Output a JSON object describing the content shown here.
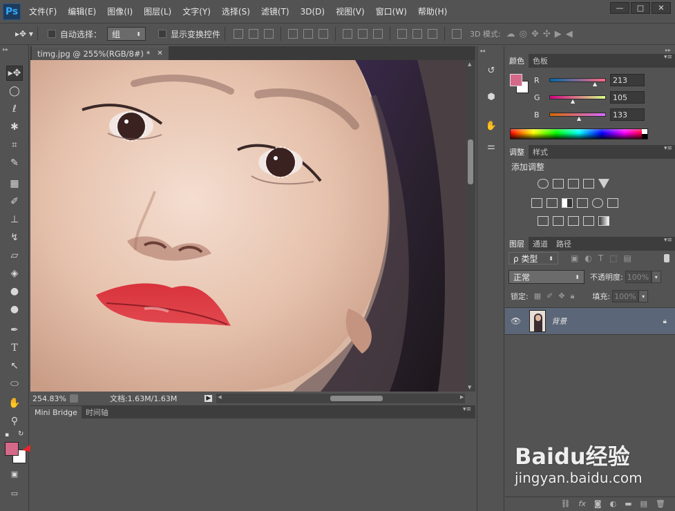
{
  "app": {
    "logo": "Ps"
  },
  "menu": [
    "文件(F)",
    "编辑(E)",
    "图像(I)",
    "图层(L)",
    "文字(Y)",
    "选择(S)",
    "滤镜(T)",
    "3D(D)",
    "视图(V)",
    "窗口(W)",
    "帮助(H)"
  ],
  "window_controls": {
    "minimize": "—",
    "maximize": "□",
    "close": "✕"
  },
  "options": {
    "auto_select_label": "自动选择：",
    "auto_select_value": "组",
    "show_transform_label": "显示变换控件",
    "mode_3d_label": "3D 模式:"
  },
  "document": {
    "tab_title": "timg.jpg @ 255%(RGB/8#) *",
    "tab_close": "✕",
    "zoom": "254.83%",
    "doc_info": "文档:1.63M/1.63M"
  },
  "bottom_panel": {
    "tabs": [
      "Mini Bridge",
      "时间轴"
    ]
  },
  "color_panel": {
    "tabs": [
      "颜色",
      "色板"
    ],
    "r_label": "R",
    "g_label": "G",
    "b_label": "B",
    "r": "213",
    "g": "105",
    "b": "133",
    "foreground": "#d5698a",
    "background": "#ffffff"
  },
  "adjust_panel": {
    "tabs": [
      "调整",
      "样式"
    ],
    "title": "添加调整"
  },
  "layers_panel": {
    "tabs": [
      "图层",
      "通道",
      "路径"
    ],
    "kind_label": "ρ 类型",
    "blend_mode": "正常",
    "opacity_label": "不透明度:",
    "opacity_value": "100%",
    "lock_label": "锁定:",
    "fill_label": "填充:",
    "fill_value": "100%",
    "layer_name": "背景"
  },
  "watermark": {
    "brand": "Baidu经验",
    "url": "jingyan.baidu.com"
  }
}
